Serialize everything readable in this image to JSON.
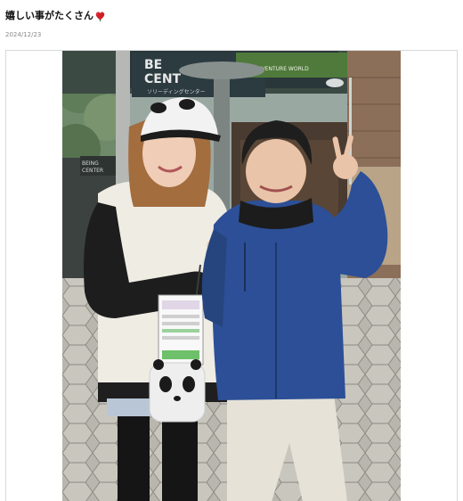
{
  "post": {
    "title": "嬉しい事がたくさん",
    "date": "2024/12/23"
  },
  "icons": {
    "title_icon": "red-heart-icon"
  },
  "photo": {
    "signage": {
      "big_sign_partial": "BE\nCENT",
      "sub_sign_partial": "ソリーディングセンター",
      "green_banner": "ADVENTURE WORLD",
      "small_sign": "BEING\nCENTER"
    }
  },
  "colors": {
    "heart": "#d11f2a",
    "title_text": "#111111",
    "date_text": "#888888",
    "frame_border": "#d8d8d8",
    "jacket_blue": "#2c4f97",
    "pants_beige": "#e6e2d8"
  }
}
